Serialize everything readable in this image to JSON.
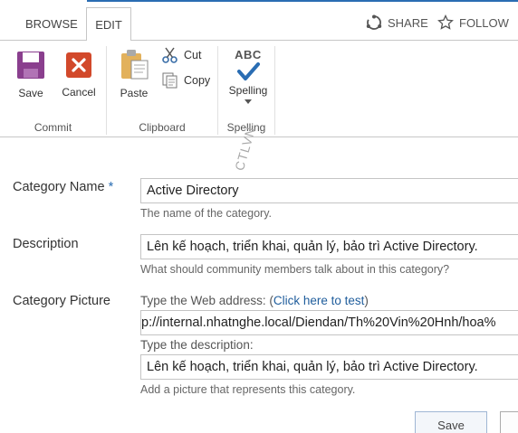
{
  "ribbon": {
    "tabs": [
      "BROWSE",
      "EDIT"
    ],
    "share_label": "SHARE",
    "follow_label": "FOLLOW",
    "save_label": "Save",
    "cancel_label": "Cancel",
    "paste_label": "Paste",
    "cut_label": "Cut",
    "copy_label": "Copy",
    "spelling_label": "Spelling",
    "spelling_abc": "ABC",
    "groups": {
      "commit": "Commit",
      "clipboard": "Clipboard",
      "spelling": "Spelling"
    }
  },
  "form": {
    "category_name": {
      "label": "Category Name",
      "required_mark": "*",
      "value": "Active Directory",
      "hint": "The name of the category."
    },
    "description": {
      "label": "Description",
      "value": "Lên kế hoạch, triển khai, quản lý, bảo trì Active Directory.",
      "hint": "What should community members talk about in this category?"
    },
    "category_picture": {
      "label": "Category Picture",
      "web_address_label": "Type the Web address: (",
      "test_link": "Click here to test",
      "web_address_close": ")",
      "url_value": "p://internal.nhatnghe.local/Diendan/Th%20Vin%20Hnh/hoa%",
      "desc_label": "Type the description:",
      "desc_value": "Lên kế hoạch, triển khai, quản lý, bảo trì Active Directory.",
      "hint": "Add a picture that represents this category."
    }
  },
  "footer": {
    "save_button": "Save"
  },
  "watermark": "CTLVN",
  "colors": {
    "accent": "#2a6db3",
    "link": "#1f5d9c",
    "save_icon": "#8a3f8e",
    "cancel_icon": "#d2492b",
    "check": "#2a6db3"
  }
}
